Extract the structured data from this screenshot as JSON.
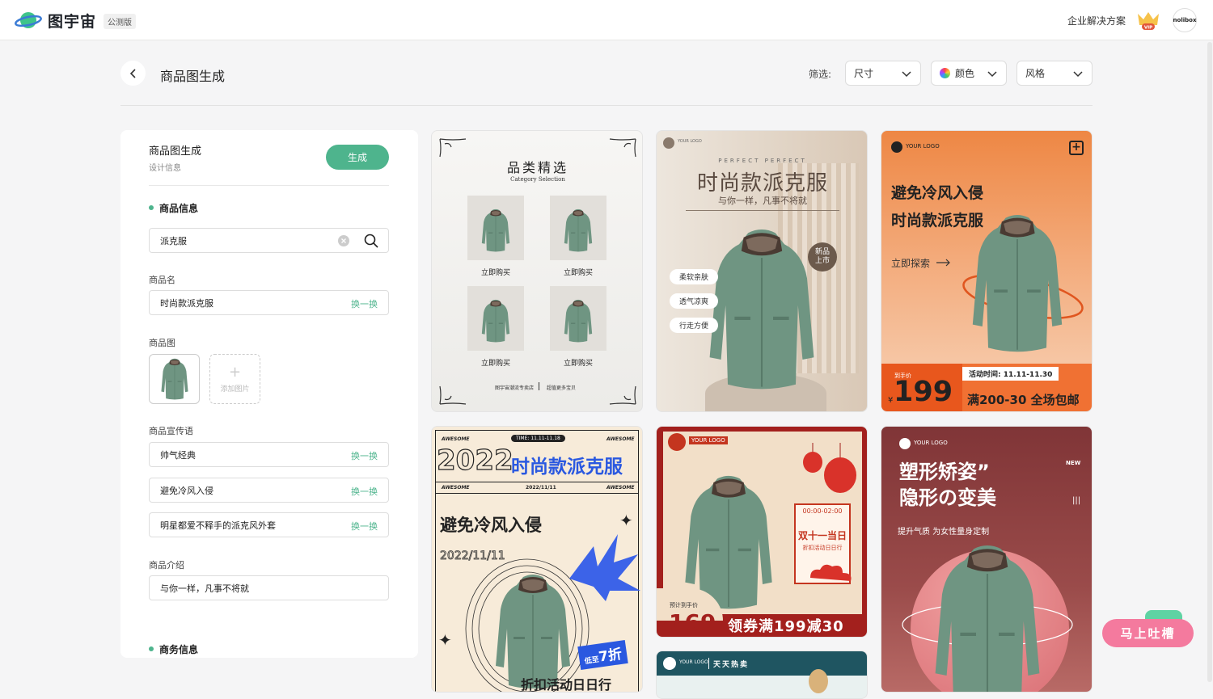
{
  "header": {
    "brand": "图宇宙",
    "beta_badge": "公测版",
    "enterprise_link": "企业解决方案",
    "vip_label": "VIP",
    "avatar_text": "nolibox"
  },
  "toolbar": {
    "page_title": "商品图生成",
    "filter_label": "筛选:",
    "filters": [
      {
        "label": "尺寸"
      },
      {
        "label": "颜色"
      },
      {
        "label": "风格"
      }
    ]
  },
  "panel": {
    "title": "商品图生成",
    "subtitle": "设计信息",
    "generate_label": "生成",
    "section_product": "商品信息",
    "search_value": "派克服",
    "name_label": "商品名",
    "name_value": "时尚款派克服",
    "swap_label": "换一换",
    "image_label": "商品图",
    "add_image_label": "添加图片",
    "slogan_label": "商品宣传语",
    "slogans": [
      "帅气经典",
      "避免冷风入侵",
      "明星都爱不释手的派克风外套"
    ],
    "intro_label": "商品介绍",
    "intro_value": "与你一样，凡事不将就",
    "section_business": "商务信息"
  },
  "cards": {
    "c1": {
      "title": "品类精选",
      "subtitle": "Category Selection",
      "buy": "立即购买",
      "footer_left": "图宇宙潮流专卖店",
      "footer_right": "超值更多宝贝"
    },
    "c2": {
      "logo": "YOUR LOGO",
      "kicker": "PERFECT PERFECT",
      "title": "时尚款派克服",
      "subtitle": "与你一样，凡事不将就",
      "badge_line1": "新品",
      "badge_line2": "上市",
      "tags": [
        "柔软亲肤",
        "透气凉爽",
        "行走方便"
      ]
    },
    "c3": {
      "logo": "YOUR LOGO",
      "line1": "避免冷风入侵",
      "line2": "时尚款派克服",
      "explore": "立即探索",
      "price_label": "到手价",
      "currency": "¥",
      "price": "199",
      "time": "活动时间: 11.11-11.30",
      "promo": "满200-30 全场包邮"
    },
    "c4": {
      "awesome": "AWESOME",
      "time": "TIME: 11.11-11.18",
      "year": "2022",
      "title": "时尚款派克服",
      "date": "2022/11/11",
      "slogan": "避免冷风入侵",
      "date_outline": "2022/11/11",
      "discount_prefix": "低至",
      "discount": "7折",
      "bottom": "折扣活动日日行"
    },
    "c5": {
      "logo": "YOUR LOGO",
      "time": "00:00-02:00",
      "event": "双十一当日",
      "event_sub": "折扣活动日日行",
      "est_label": "预计到手价",
      "currency": "¥",
      "price": "169",
      "coupon": "领券满199减30"
    },
    "c6": {
      "logo": "YOUR LOGO",
      "line1": "塑形矫姿”",
      "line2": "隐形の变美",
      "new": "NEW",
      "sub": "提升气质 为女性量身定制"
    },
    "c7": {
      "logo": "YOUR LOGO",
      "tag": "天天热卖"
    }
  },
  "feedback": {
    "label": "马上吐槽"
  },
  "colors": {
    "accent": "#4eb48d",
    "coat": "#6f9582",
    "orange": "#ee8744",
    "red": "#a3201d",
    "maroon": "#8a3b3c",
    "feedback": "#f47a9e"
  }
}
